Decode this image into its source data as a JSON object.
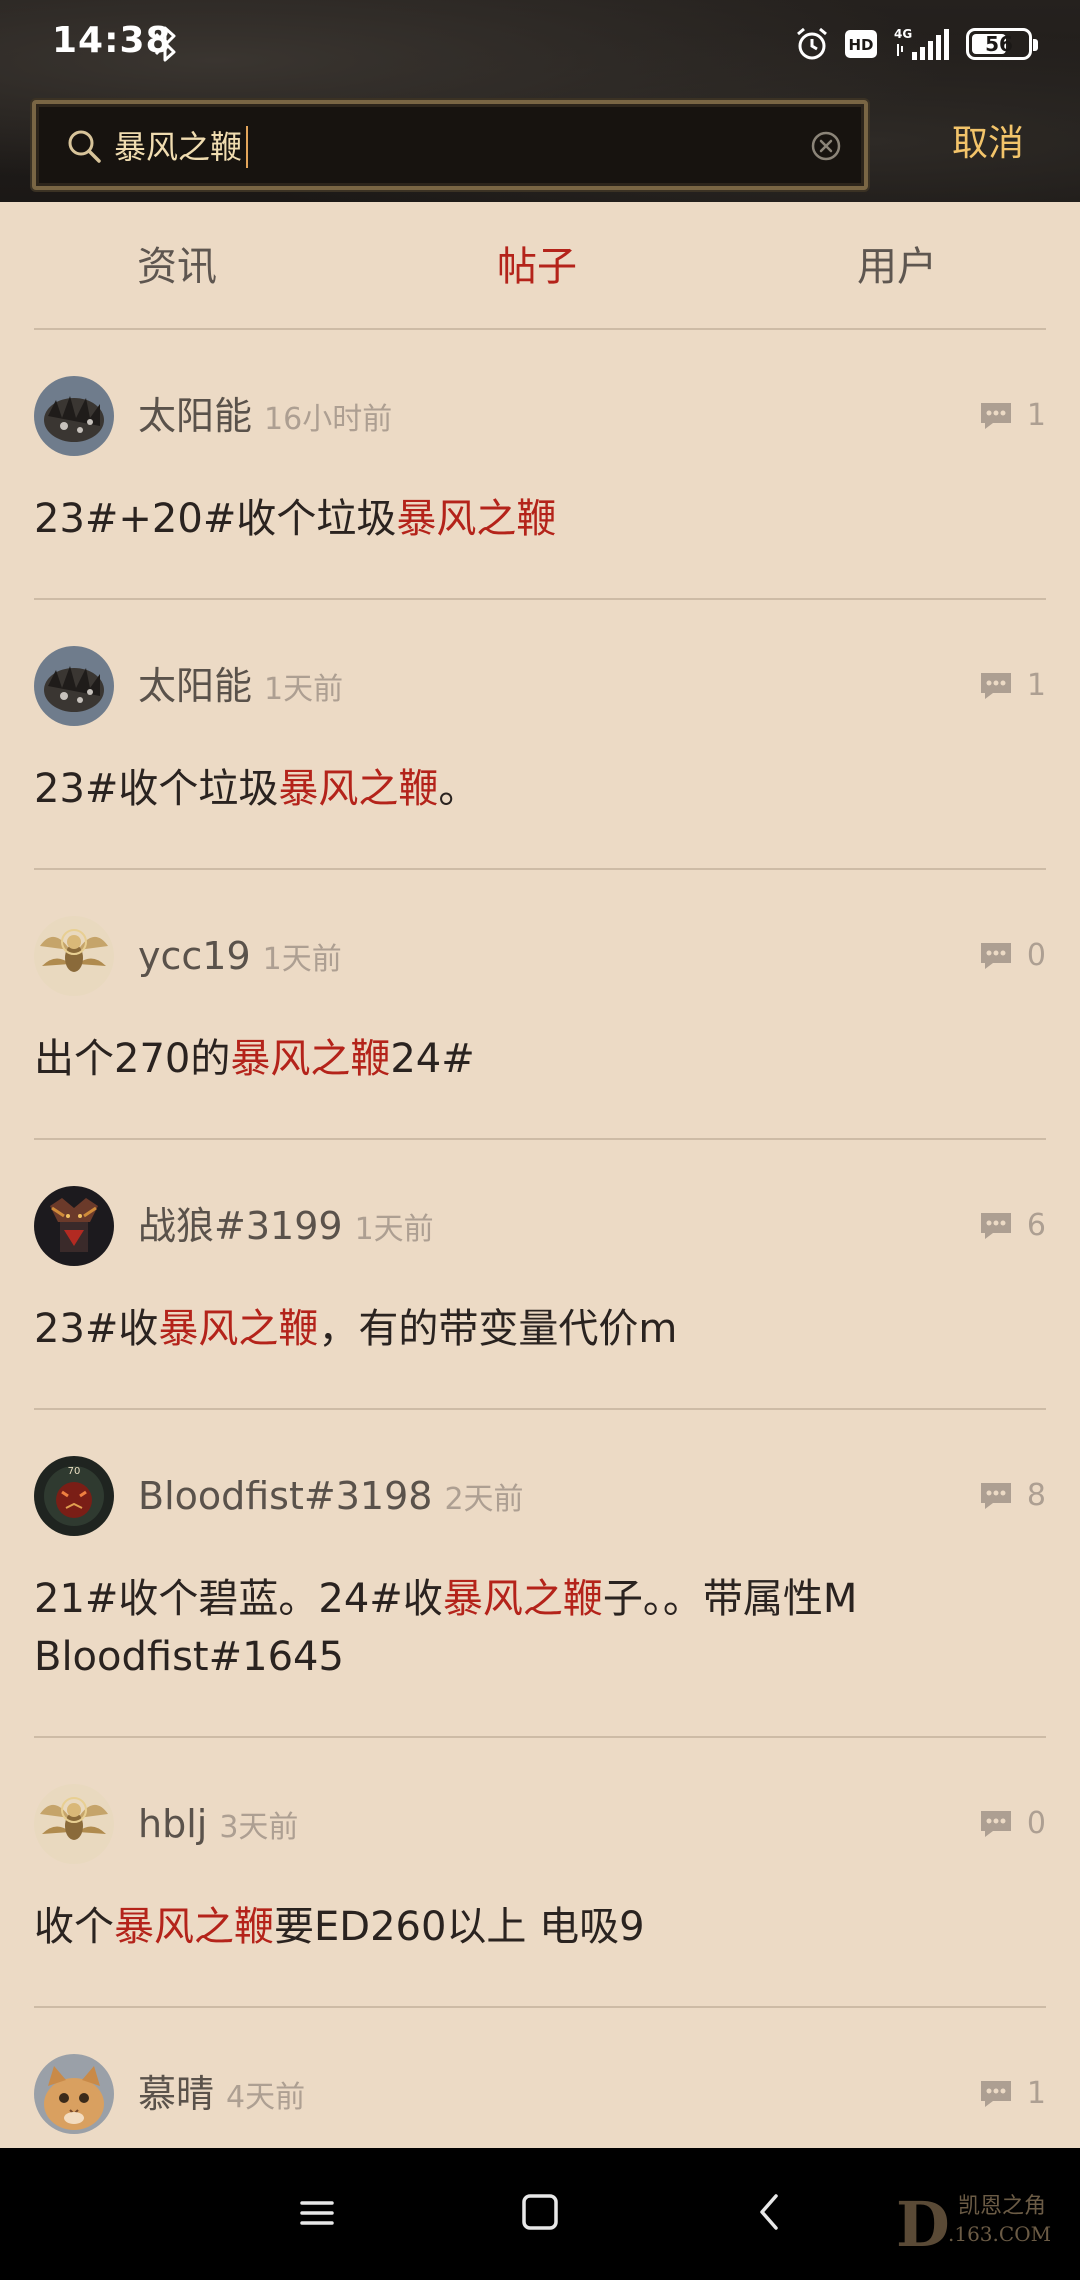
{
  "status_bar": {
    "time": "14:38",
    "hd": "HD",
    "network": "4G",
    "battery": "56"
  },
  "search": {
    "value": "暴风之鞭",
    "cancel_label": "取消"
  },
  "tabs": [
    {
      "label": "资讯"
    },
    {
      "label": "帖子",
      "active": true
    },
    {
      "label": "用户"
    }
  ],
  "posts": [
    {
      "username": "太阳能",
      "time": "16小时前",
      "comments": "1",
      "avatar": "dark-spiky-avatar",
      "text_before": "23#+20#收个垃圾",
      "highlight": "暴风之鞭",
      "text_after": ""
    },
    {
      "username": "太阳能",
      "time": "1天前",
      "comments": "1",
      "avatar": "dark-spiky-avatar",
      "text_before": "23#收个垃圾",
      "highlight": "暴风之鞭",
      "text_after": "。"
    },
    {
      "username": "ycc19",
      "time": "1天前",
      "comments": "0",
      "avatar": "golden-angel-avatar",
      "text_before": "出个270的",
      "highlight": "暴风之鞭",
      "text_after": "24#"
    },
    {
      "username": "战狼#3199",
      "time": "1天前",
      "comments": "6",
      "avatar": "warrior-avatar",
      "text_before": "23#收",
      "highlight": "暴风之鞭",
      "text_after": "，有的带变量代价m"
    },
    {
      "username": "Bloodfist#3198",
      "time": "2天前",
      "comments": "8",
      "avatar": "demon-level-70-avatar",
      "text_before": "21#收个碧蓝。24#收",
      "highlight": "暴风之鞭",
      "text_after": "子。。带属性M Bloodfist#1645"
    },
    {
      "username": "hblj",
      "time": "3天前",
      "comments": "0",
      "avatar": "golden-angel-avatar",
      "text_before": "收个",
      "highlight": "暴风之鞭",
      "text_after": "要ED260以上 电吸9"
    },
    {
      "username": "慕晴",
      "time": "4天前",
      "comments": "1",
      "avatar": "cat-avatar",
      "text_before": "",
      "highlight": "",
      "text_after": ""
    }
  ],
  "watermark": {
    "title": "凯恩之角",
    "subtitle": ".163.COM",
    "letter": "D"
  },
  "colors": {
    "highlight": "#b4231a",
    "accent": "#f3c46a",
    "background": "#ecdac5"
  }
}
